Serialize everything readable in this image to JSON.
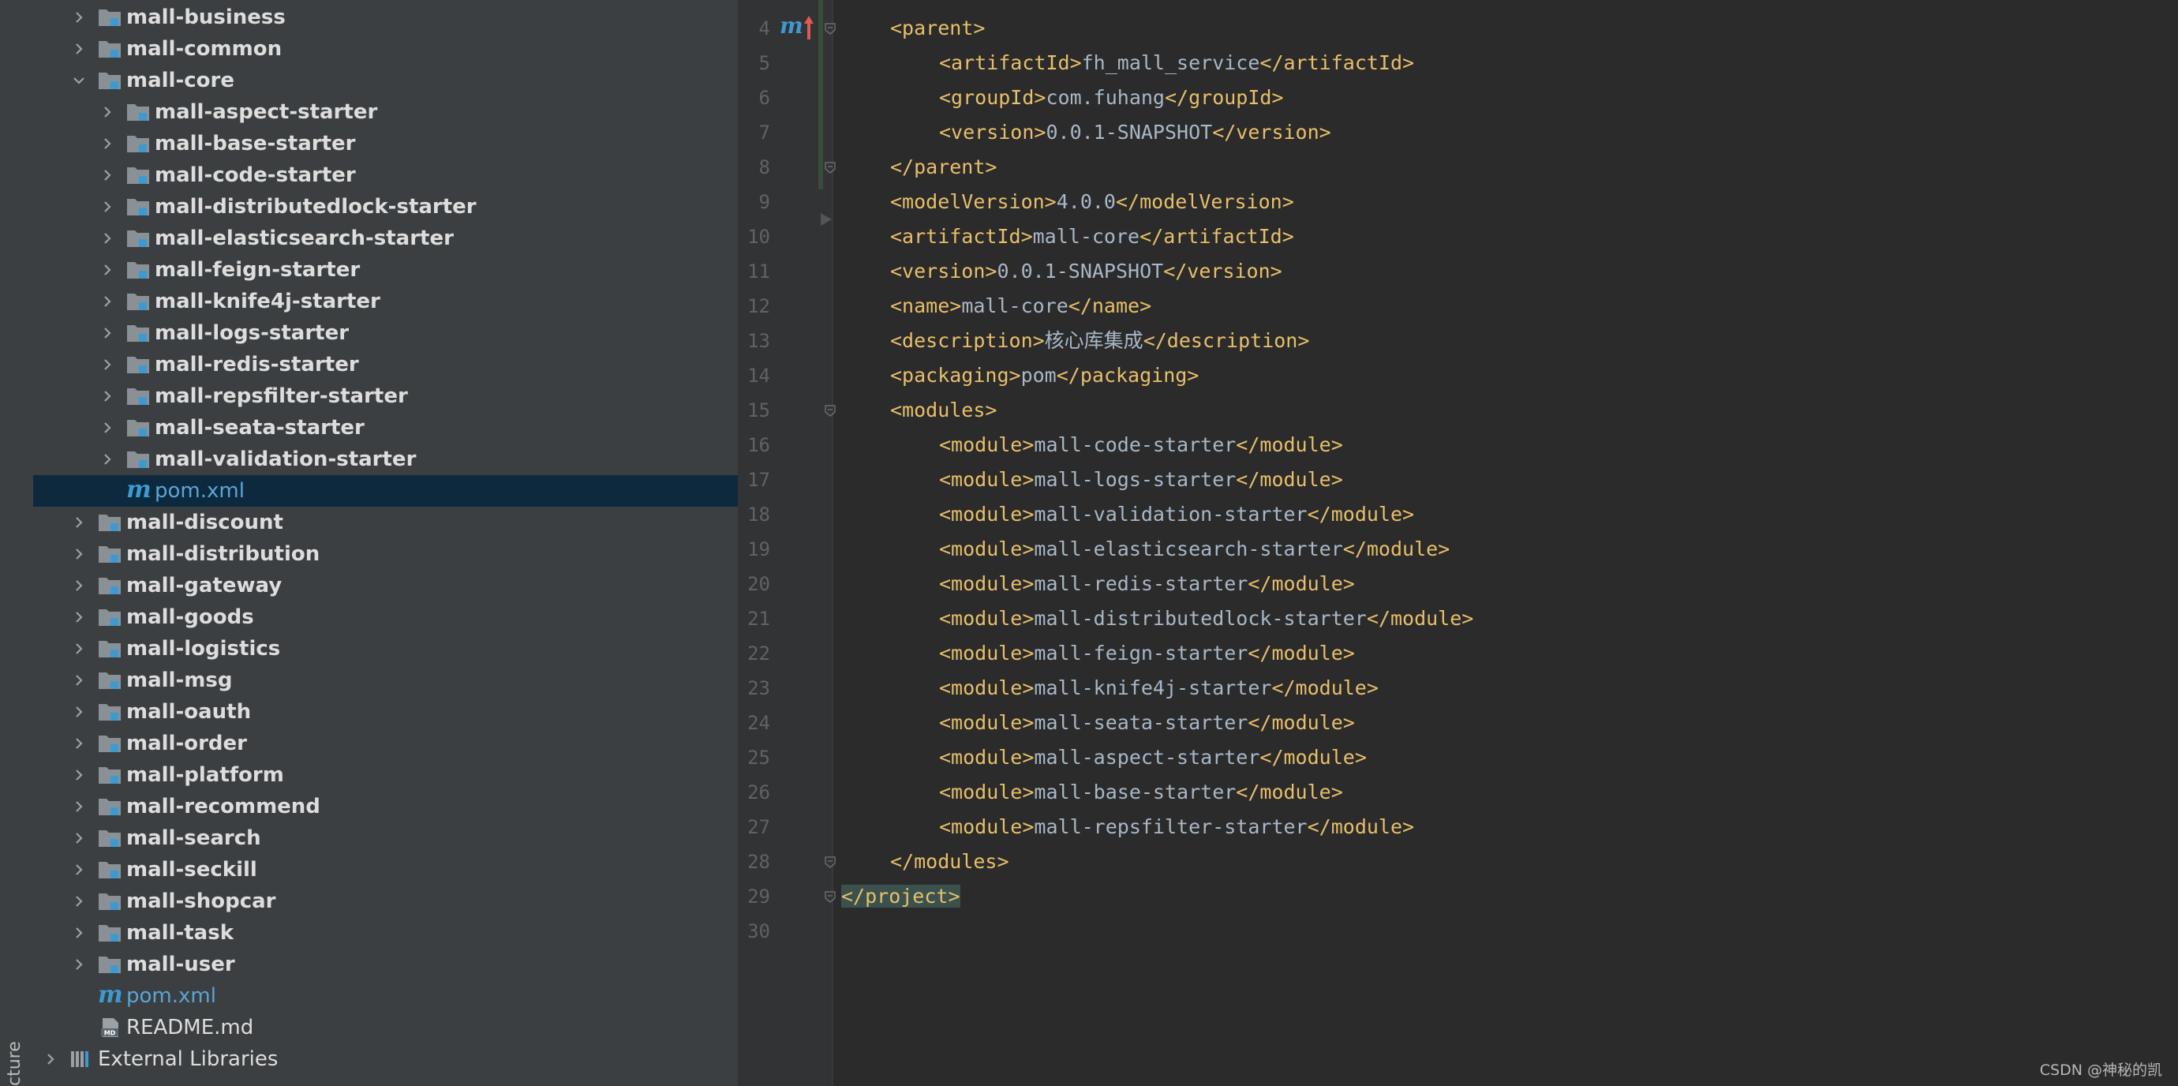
{
  "sidebar": {
    "vertical_tab": "cture"
  },
  "project_tree": [
    {
      "label": "mall-business",
      "level": 1,
      "kind": "module",
      "expanded": false
    },
    {
      "label": "mall-common",
      "level": 1,
      "kind": "module",
      "expanded": false
    },
    {
      "label": "mall-core",
      "level": 1,
      "kind": "module",
      "expanded": true
    },
    {
      "label": "mall-aspect-starter",
      "level": 2,
      "kind": "module",
      "expanded": false
    },
    {
      "label": "mall-base-starter",
      "level": 2,
      "kind": "module",
      "expanded": false
    },
    {
      "label": "mall-code-starter",
      "level": 2,
      "kind": "module",
      "expanded": false
    },
    {
      "label": "mall-distributedlock-starter",
      "level": 2,
      "kind": "module",
      "expanded": false
    },
    {
      "label": "mall-elasticsearch-starter",
      "level": 2,
      "kind": "module",
      "expanded": false
    },
    {
      "label": "mall-feign-starter",
      "level": 2,
      "kind": "module",
      "expanded": false
    },
    {
      "label": "mall-knife4j-starter",
      "level": 2,
      "kind": "module",
      "expanded": false
    },
    {
      "label": "mall-logs-starter",
      "level": 2,
      "kind": "module",
      "expanded": false
    },
    {
      "label": "mall-redis-starter",
      "level": 2,
      "kind": "module",
      "expanded": false
    },
    {
      "label": "mall-repsfilter-starter",
      "level": 2,
      "kind": "module",
      "expanded": false
    },
    {
      "label": "mall-seata-starter",
      "level": 2,
      "kind": "module",
      "expanded": false
    },
    {
      "label": "mall-validation-starter",
      "level": 2,
      "kind": "module",
      "expanded": false
    },
    {
      "label": "pom.xml",
      "level": 2,
      "kind": "pom",
      "selected": true
    },
    {
      "label": "mall-discount",
      "level": 1,
      "kind": "module",
      "expanded": false
    },
    {
      "label": "mall-distribution",
      "level": 1,
      "kind": "module",
      "expanded": false
    },
    {
      "label": "mall-gateway",
      "level": 1,
      "kind": "module",
      "expanded": false
    },
    {
      "label": "mall-goods",
      "level": 1,
      "kind": "module",
      "expanded": false
    },
    {
      "label": "mall-logistics",
      "level": 1,
      "kind": "module",
      "expanded": false
    },
    {
      "label": "mall-msg",
      "level": 1,
      "kind": "module",
      "expanded": false
    },
    {
      "label": "mall-oauth",
      "level": 1,
      "kind": "module",
      "expanded": false
    },
    {
      "label": "mall-order",
      "level": 1,
      "kind": "module",
      "expanded": false
    },
    {
      "label": "mall-platform",
      "level": 1,
      "kind": "module",
      "expanded": false
    },
    {
      "label": "mall-recommend",
      "level": 1,
      "kind": "module",
      "expanded": false
    },
    {
      "label": "mall-search",
      "level": 1,
      "kind": "module",
      "expanded": false
    },
    {
      "label": "mall-seckill",
      "level": 1,
      "kind": "module",
      "expanded": false
    },
    {
      "label": "mall-shopcar",
      "level": 1,
      "kind": "module",
      "expanded": false
    },
    {
      "label": "mall-task",
      "level": 1,
      "kind": "module",
      "expanded": false
    },
    {
      "label": "mall-user",
      "level": 1,
      "kind": "module",
      "expanded": false
    },
    {
      "label": "pom.xml",
      "level": 1,
      "kind": "pom"
    },
    {
      "label": "README.md",
      "level": 1,
      "kind": "md"
    },
    {
      "label": "External Libraries",
      "level": 0,
      "kind": "libs",
      "expanded": false
    }
  ],
  "editor": {
    "gutter_mark": "m",
    "lines": [
      {
        "n": "4",
        "indent": 1,
        "parts": [
          {
            "t": "tag",
            "s": "<parent>"
          }
        ]
      },
      {
        "n": "5",
        "indent": 2,
        "parts": [
          {
            "t": "tag",
            "s": "<artifactId>"
          },
          {
            "t": "txt",
            "s": "fh_mall_service"
          },
          {
            "t": "tag",
            "s": "</artifactId>"
          }
        ]
      },
      {
        "n": "6",
        "indent": 2,
        "parts": [
          {
            "t": "tag",
            "s": "<groupId>"
          },
          {
            "t": "txt",
            "s": "com.fuhang"
          },
          {
            "t": "tag",
            "s": "</groupId>"
          }
        ]
      },
      {
        "n": "7",
        "indent": 2,
        "parts": [
          {
            "t": "tag",
            "s": "<version>"
          },
          {
            "t": "txt",
            "s": "0.0.1-SNAPSHOT"
          },
          {
            "t": "tag",
            "s": "</version>"
          }
        ]
      },
      {
        "n": "8",
        "indent": 1,
        "parts": [
          {
            "t": "tag",
            "s": "</parent>"
          }
        ]
      },
      {
        "n": "9",
        "indent": 1,
        "parts": [
          {
            "t": "tag",
            "s": "<modelVersion>"
          },
          {
            "t": "txt",
            "s": "4.0.0"
          },
          {
            "t": "tag",
            "s": "</modelVersion>"
          }
        ]
      },
      {
        "n": "10",
        "indent": 1,
        "parts": [
          {
            "t": "tag",
            "s": "<artifactId>"
          },
          {
            "t": "txt",
            "s": "mall-core"
          },
          {
            "t": "tag",
            "s": "</artifactId>"
          }
        ]
      },
      {
        "n": "11",
        "indent": 1,
        "parts": [
          {
            "t": "tag",
            "s": "<version>"
          },
          {
            "t": "txt",
            "s": "0.0.1-SNAPSHOT"
          },
          {
            "t": "tag",
            "s": "</version>"
          }
        ]
      },
      {
        "n": "12",
        "indent": 1,
        "parts": [
          {
            "t": "tag",
            "s": "<name>"
          },
          {
            "t": "txt",
            "s": "mall-core"
          },
          {
            "t": "tag",
            "s": "</name>"
          }
        ]
      },
      {
        "n": "13",
        "indent": 1,
        "parts": [
          {
            "t": "tag",
            "s": "<description>"
          },
          {
            "t": "txt",
            "s": "核心库集成"
          },
          {
            "t": "tag",
            "s": "</description>"
          }
        ]
      },
      {
        "n": "14",
        "indent": 1,
        "parts": [
          {
            "t": "tag",
            "s": "<packaging>"
          },
          {
            "t": "txt",
            "s": "pom"
          },
          {
            "t": "tag",
            "s": "</packaging>"
          }
        ]
      },
      {
        "n": "15",
        "indent": 1,
        "parts": [
          {
            "t": "tag",
            "s": "<modules>"
          }
        ]
      },
      {
        "n": "16",
        "indent": 2,
        "parts": [
          {
            "t": "tag",
            "s": "<module>"
          },
          {
            "t": "txt",
            "s": "mall-code-starter"
          },
          {
            "t": "tag",
            "s": "</module>"
          }
        ]
      },
      {
        "n": "17",
        "indent": 2,
        "parts": [
          {
            "t": "tag",
            "s": "<module>"
          },
          {
            "t": "txt",
            "s": "mall-logs-starter"
          },
          {
            "t": "tag",
            "s": "</module>"
          }
        ]
      },
      {
        "n": "18",
        "indent": 2,
        "parts": [
          {
            "t": "tag",
            "s": "<module>"
          },
          {
            "t": "txt",
            "s": "mall-validation-starter"
          },
          {
            "t": "tag",
            "s": "</module>"
          }
        ]
      },
      {
        "n": "19",
        "indent": 2,
        "parts": [
          {
            "t": "tag",
            "s": "<module>"
          },
          {
            "t": "txt",
            "s": "mall-elasticsearch-starter"
          },
          {
            "t": "tag",
            "s": "</module>"
          }
        ]
      },
      {
        "n": "20",
        "indent": 2,
        "parts": [
          {
            "t": "tag",
            "s": "<module>"
          },
          {
            "t": "txt",
            "s": "mall-redis-starter"
          },
          {
            "t": "tag",
            "s": "</module>"
          }
        ]
      },
      {
        "n": "21",
        "indent": 2,
        "parts": [
          {
            "t": "tag",
            "s": "<module>"
          },
          {
            "t": "txt",
            "s": "mall-distributedlock-starter"
          },
          {
            "t": "tag",
            "s": "</module>"
          }
        ]
      },
      {
        "n": "22",
        "indent": 2,
        "parts": [
          {
            "t": "tag",
            "s": "<module>"
          },
          {
            "t": "txt",
            "s": "mall-feign-starter"
          },
          {
            "t": "tag",
            "s": "</module>"
          }
        ]
      },
      {
        "n": "23",
        "indent": 2,
        "parts": [
          {
            "t": "tag",
            "s": "<module>"
          },
          {
            "t": "txt",
            "s": "mall-knife4j-starter"
          },
          {
            "t": "tag",
            "s": "</module>"
          }
        ]
      },
      {
        "n": "24",
        "indent": 2,
        "parts": [
          {
            "t": "tag",
            "s": "<module>"
          },
          {
            "t": "txt",
            "s": "mall-seata-starter"
          },
          {
            "t": "tag",
            "s": "</module>"
          }
        ]
      },
      {
        "n": "25",
        "indent": 2,
        "parts": [
          {
            "t": "tag",
            "s": "<module>"
          },
          {
            "t": "txt",
            "s": "mall-aspect-starter"
          },
          {
            "t": "tag",
            "s": "</module>"
          }
        ]
      },
      {
        "n": "26",
        "indent": 2,
        "parts": [
          {
            "t": "tag",
            "s": "<module>"
          },
          {
            "t": "txt",
            "s": "mall-base-starter"
          },
          {
            "t": "tag",
            "s": "</module>"
          }
        ]
      },
      {
        "n": "27",
        "indent": 2,
        "parts": [
          {
            "t": "tag",
            "s": "<module>"
          },
          {
            "t": "txt",
            "s": "mall-repsfilter-starter"
          },
          {
            "t": "tag",
            "s": "</module>"
          }
        ]
      },
      {
        "n": "28",
        "indent": 1,
        "parts": [
          {
            "t": "tag",
            "s": "</modules>"
          }
        ]
      },
      {
        "n": "29",
        "indent": 0,
        "parts": [
          {
            "t": "hl",
            "s": "</project>"
          }
        ]
      },
      {
        "n": "30",
        "indent": 0,
        "parts": []
      }
    ]
  },
  "watermark": "CSDN @神秘的凯",
  "colors": {
    "panel_bg": "#3c3f41",
    "editor_bg": "#2b2b2b",
    "selection": "#0d293e",
    "tag": "#e8bf6a",
    "text": "#a9b7c6",
    "maven_blue": "#3d9ad1"
  }
}
